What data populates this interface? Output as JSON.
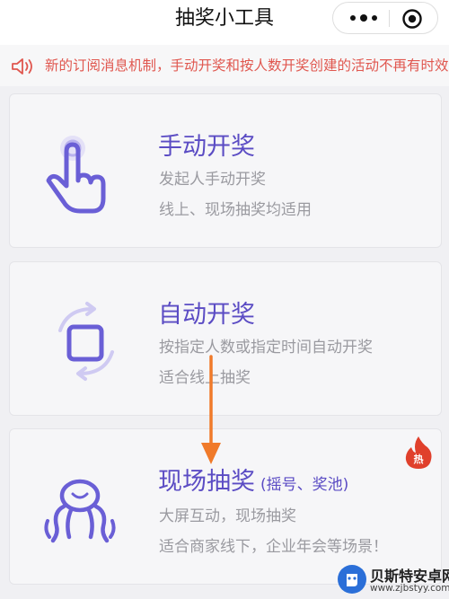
{
  "nav": {
    "title": "抽奖小工具",
    "more_icon": "more-dots-icon",
    "close_icon": "target-close-icon"
  },
  "notice": {
    "icon": "speaker-icon",
    "text": "新的订阅消息机制，手动开奖和按人数开奖创建的活动不再有时效"
  },
  "cards": [
    {
      "title": "手动开奖",
      "line1": "发起人手动开奖",
      "line2": "线上、现场抽奖均适用",
      "icon": "hand-tap-icon"
    },
    {
      "title": "自动开奖",
      "line1": "按指定人数或指定时间自动开奖",
      "line2": "适合线上抽奖",
      "icon": "auto-cycle-icon"
    },
    {
      "title": "现场抽奖",
      "subtitle": "(摇号、奖池)",
      "line1": "大屏互动，现场抽奖",
      "line2": "适合商家线下，企业年会等场景！",
      "icon": "crowd-icon",
      "badge": "热"
    }
  ],
  "watermark": {
    "name": "贝斯特安卓网",
    "url": "www.zjbstyy.com"
  },
  "colors": {
    "accent": "#5b4cc4",
    "notice": "#e0574f",
    "arrow": "#f07a2a",
    "icon": "#6a5fd6"
  }
}
